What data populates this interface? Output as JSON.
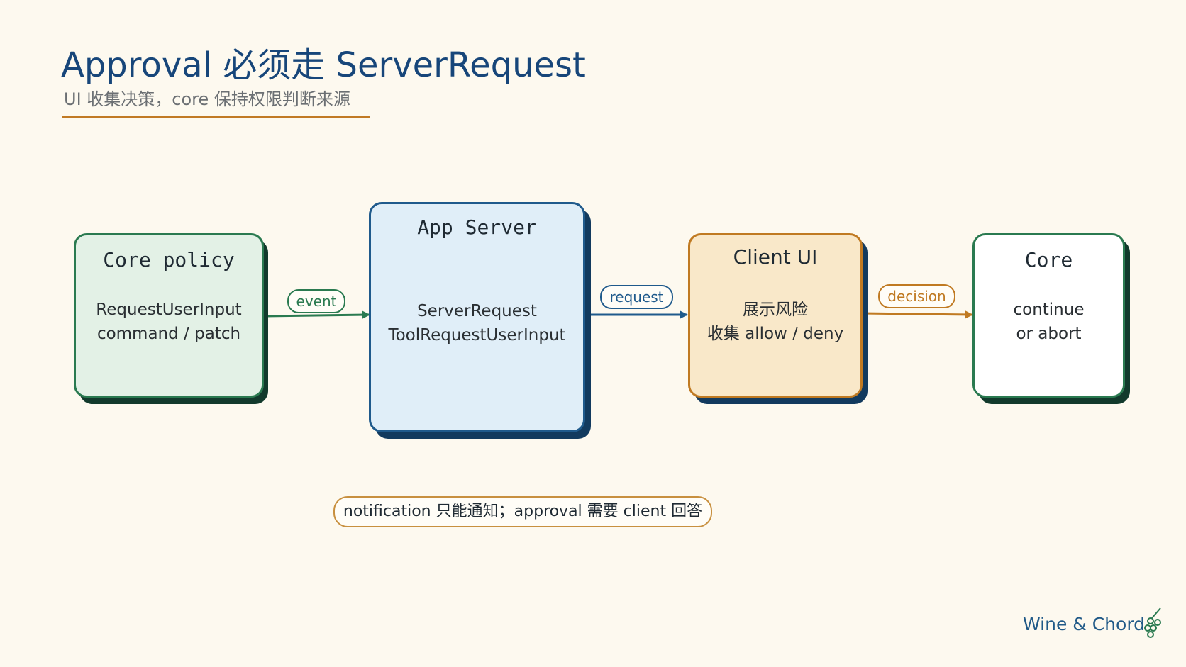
{
  "header": {
    "title": "Approval 必须走 ServerRequest",
    "subtitle": "UI 收集决策，core 保持权限判断来源"
  },
  "nodes": {
    "core_policy": {
      "title": "Core policy",
      "lines": [
        "RequestUserInput",
        "command / patch"
      ]
    },
    "app_server": {
      "title": "App Server",
      "lines": [
        "ServerRequest",
        "ToolRequestUserInput"
      ]
    },
    "client_ui": {
      "title": "Client UI",
      "lines": [
        "展示风险",
        "收集 allow / deny"
      ]
    },
    "core": {
      "title": "Core",
      "lines": [
        "continue",
        "or abort"
      ]
    }
  },
  "edges": {
    "event": "event",
    "request": "request",
    "decision": "decision"
  },
  "note": "notification 只能通知；approval 需要 client 回答",
  "brand": "Wine & Chord",
  "colors": {
    "green": "#2a7a50",
    "blue": "#1f5a8c",
    "orange": "#c07a22",
    "navy_shadow": "#123a5e",
    "accent_rule": "#c17a24"
  }
}
